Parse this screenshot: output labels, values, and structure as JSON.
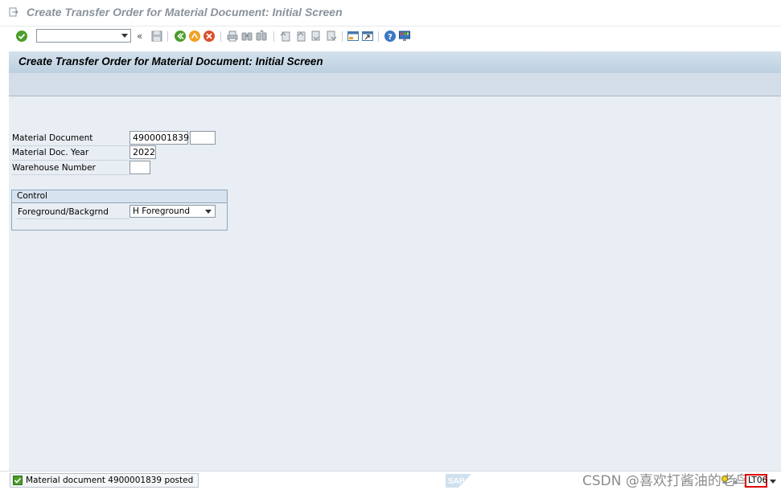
{
  "window": {
    "title": "Create Transfer Order for Material Document: Initial Screen"
  },
  "toolbar": {
    "command_field_value": "",
    "history_label": "«",
    "icons": [
      "enter-icon",
      "save-icon",
      "back-icon",
      "exit-icon",
      "cancel-icon",
      "print-icon",
      "find-icon",
      "find-next-icon",
      "first-page-icon",
      "previous-page-icon",
      "next-page-icon",
      "last-page-icon",
      "create-session-icon",
      "shortcut-icon",
      "help-icon",
      "customize-layout-icon"
    ]
  },
  "screen": {
    "title": "Create Transfer Order for Material Document: Initial Screen"
  },
  "form": {
    "material_document": {
      "label": "Material Document",
      "value": "4900001839",
      "item_value": ""
    },
    "material_doc_year": {
      "label": "Material Doc. Year",
      "value": "2022"
    },
    "warehouse_number": {
      "label": "Warehouse Number",
      "value": ""
    }
  },
  "control_group": {
    "title": "Control",
    "foreground_background": {
      "label": "Foreground/Backgrnd",
      "value": "H Foreground"
    }
  },
  "status_bar": {
    "message": "Material document 4900001839 posted",
    "message_type": "success",
    "watermark": "CSDN @喜欢打酱油的老鸟",
    "transaction_code": "LT06"
  },
  "colors": {
    "main_background": "#e8eef3",
    "header_gradient_top": "#d4e1ec",
    "header_gradient_bottom": "#bcd0e1",
    "success": "#4c9d2c",
    "highlight_border": "#e00000"
  }
}
